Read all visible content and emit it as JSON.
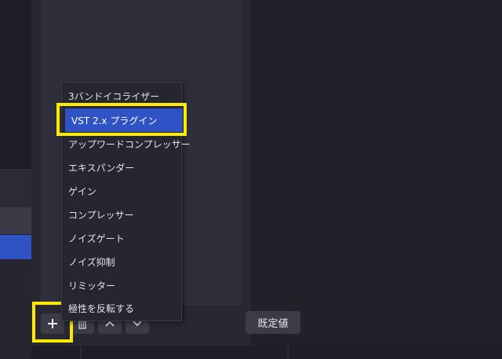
{
  "menu": {
    "items": [
      {
        "label": "3バンドイコライザー"
      },
      {
        "label": "VST 2.x プラグイン"
      },
      {
        "label": "アップワードコンプレッサー"
      },
      {
        "label": "エキスパンダー"
      },
      {
        "label": "ゲイン"
      },
      {
        "label": "コンプレッサー"
      },
      {
        "label": "ノイズゲート"
      },
      {
        "label": "ノイズ抑制"
      },
      {
        "label": "リミッター"
      },
      {
        "label": "極性を反転する"
      }
    ],
    "selected_index": 1
  },
  "toolbar": {
    "add_icon": "plus-icon",
    "delete_icon": "trash-icon",
    "move_up_icon": "chevron-up-icon",
    "move_down_icon": "chevron-down-icon",
    "defaults_label": "既定値"
  },
  "colors": {
    "selection": "#2f53c4",
    "highlight": "#ffeb00",
    "background": "#1e1f27"
  }
}
